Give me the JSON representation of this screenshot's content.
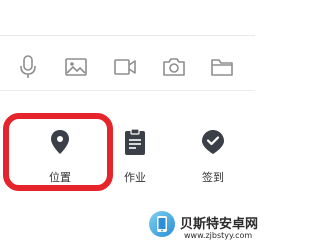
{
  "toolbar": {
    "icons": [
      "microphone-icon",
      "image-icon",
      "video-icon",
      "camera-icon",
      "folder-icon"
    ]
  },
  "actions": [
    {
      "label": "位置",
      "icon": "location-pin-icon"
    },
    {
      "label": "作业",
      "icon": "clipboard-icon"
    },
    {
      "label": "签到",
      "icon": "check-shield-icon"
    }
  ],
  "highlight_color": "#e5242b",
  "watermark": {
    "title": "贝斯特安卓网",
    "url": "www.zjbstyy.com"
  }
}
